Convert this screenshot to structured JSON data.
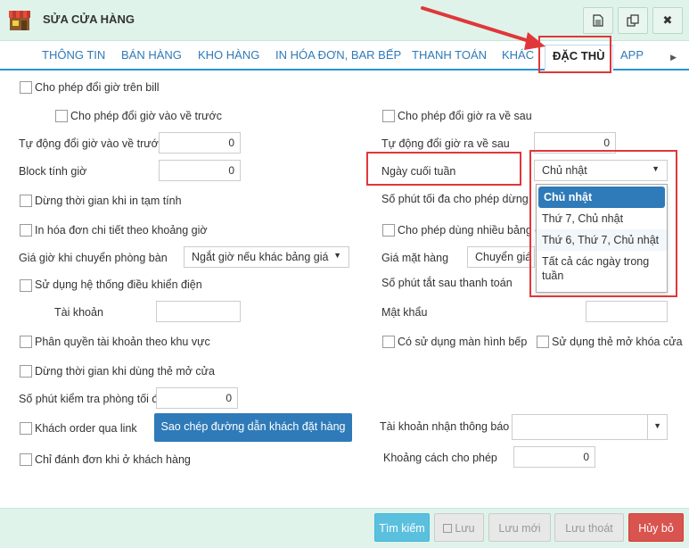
{
  "window": {
    "title": "SỬA CỬA HÀNG",
    "buttons": [
      "document-icon",
      "copy-icon",
      "close-icon"
    ],
    "close_label": "✖"
  },
  "tabs": [
    {
      "label": "THÔNG TIN"
    },
    {
      "label": "BÁN HÀNG"
    },
    {
      "label": "KHO HÀNG"
    },
    {
      "label": "IN HÓA ĐƠN, BAR BẾP"
    },
    {
      "label": "THANH TOÁN"
    },
    {
      "label": "KHÁC"
    },
    {
      "label": "ĐẶC THÙ",
      "active": true
    },
    {
      "label": "APP"
    }
  ],
  "form": {
    "change_time_on_bill": "Cho phép đổi giờ trên bill",
    "change_time_in_earlier": "Cho phép đổi giờ vào về trước",
    "change_time_out_later": "Cho phép đổi giờ ra về sau",
    "auto_change_in_earlier": {
      "label": "Tự động đổi giờ vào về trước",
      "value": "0"
    },
    "auto_change_out_later": {
      "label": "Tự động đổi giờ ra về sau",
      "value": "0"
    },
    "block_time": {
      "label": "Block tính giờ",
      "value": "0"
    },
    "weekend": {
      "label": "Ngày cuối tuần",
      "value": "Chủ nhật"
    },
    "stop_time_on_print": "Dừng thời gian khi in tạm tính",
    "max_minutes_allowed": "Số phút tối đa cho phép dừng",
    "print_detail_by_time": "In hóa đơn chi tiết theo khoảng giờ",
    "allow_multi_price": "Cho phép dùng nhiều bảng giá",
    "price_on_room_change": {
      "label": "Giá giờ khi chuyển phòng bàn",
      "value": "Ngắt giờ nếu khác bảng giá"
    },
    "item_price": {
      "label": "Giá mặt hàng",
      "value": "Chuyển giá"
    },
    "use_electric_control": "Sử dụng hệ thống điều khiển điện",
    "auto_off_minutes": "Số phút tắt sau thanh toán",
    "account": {
      "label": "Tài khoản",
      "value": ""
    },
    "password": {
      "label": "Mật khẩu",
      "value": ""
    },
    "account_by_area": "Phân quyền tài khoản theo khu vực",
    "kitchen_screen": "Có sử dụng màn hình bếp",
    "door_card": "Sử dụng thẻ mở khóa cửa",
    "stop_time_on_card": "Dừng thời gian khi dùng thẻ mở cửa",
    "max_room_check": {
      "label": "Số phút kiểm tra phòng tối đa",
      "value": "0"
    },
    "customer_order_link": "Khách order qua link",
    "copy_link_button": "Sao chép đường dẫn khách đặt hàng",
    "notify_account": {
      "label": "Tài khoản nhận thông báo",
      "value": ""
    },
    "customer_only_here": "Chỉ đánh đơn khi ở khách hàng",
    "allowed_distance": {
      "label": "Khoảng cách cho phép",
      "value": "0"
    }
  },
  "weekend_options": [
    {
      "label": "Chủ nhật",
      "selected": true
    },
    {
      "label": "Thứ 7, Chủ nhật"
    },
    {
      "label": "Thứ 6, Thứ 7, Chủ nhật"
    },
    {
      "label": "Tất cả các ngày trong tuần"
    }
  ],
  "footer": {
    "search": "Tìm kiếm",
    "save": "Lưu",
    "save_new": "Lưu mới",
    "save_exit": "Lưu thoát",
    "cancel": "Hủy bỏ"
  },
  "colors": {
    "accent": "#2f7ab8",
    "header_bg": "#dff3ea",
    "annotation_red": "#e0373a",
    "cancel_red": "#d9534f"
  }
}
